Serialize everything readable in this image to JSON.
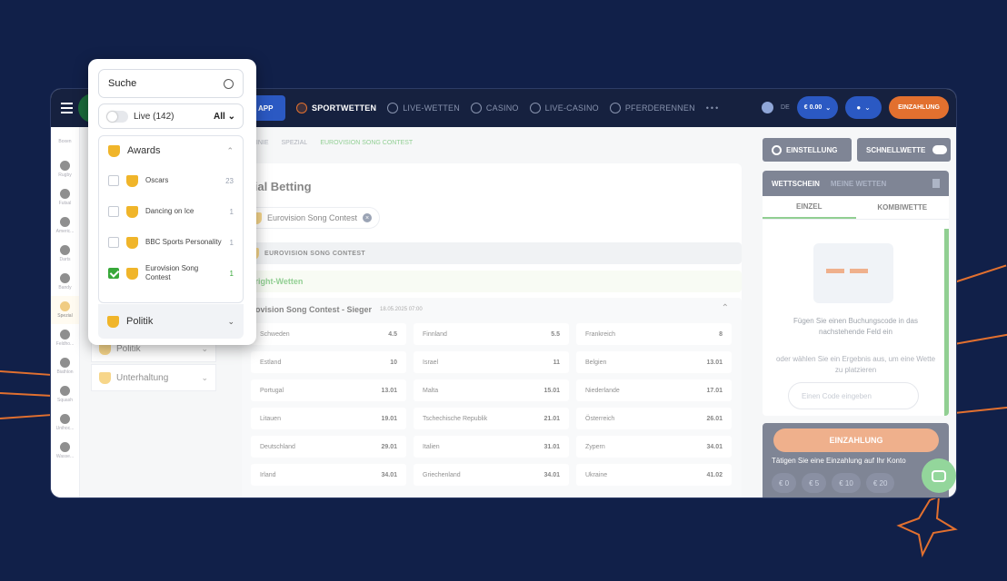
{
  "nav": {
    "app": "APP",
    "items": [
      "SPORTWETTEN",
      "LIVE-WETTEN",
      "CASINO",
      "LIVE-CASINO",
      "PFERDERENNEN"
    ],
    "more": "•••"
  },
  "header_right": {
    "lang": "DE",
    "balance": "€ 0.00",
    "deposit": "EINZAHLUNG"
  },
  "sport_rail": [
    "Boxen",
    "Rugby",
    "Futsal",
    "Americ...",
    "Darts",
    "Bandy",
    "Spezial",
    "Feldho...",
    "Biathlon",
    "Squash",
    "Unihoc...",
    "Wasse..."
  ],
  "left_panel": {
    "items": [
      "Politik",
      "Unterhaltung"
    ]
  },
  "breadcrumb": [
    "LINIE",
    "SPEZIAL",
    "EUROVISION SONG CONTEST"
  ],
  "main": {
    "title": "ezial Betting",
    "chip": "Eurovision Song Contest",
    "section": "EUROVISION SONG CONTEST",
    "subsection": "utright-Wetten",
    "market_title": "urovision Song Contest - Sieger",
    "market_date": "18.05.2025 07:00",
    "odds": [
      [
        "Schweden",
        "4.5"
      ],
      [
        "Finnland",
        "5.5"
      ],
      [
        "Frankreich",
        "8"
      ],
      [
        "Estland",
        "10"
      ],
      [
        "Israel",
        "11"
      ],
      [
        "Belgien",
        "13.01"
      ],
      [
        "Portugal",
        "13.01"
      ],
      [
        "Malta",
        "15.01"
      ],
      [
        "Niederlande",
        "17.01"
      ],
      [
        "Litauen",
        "19.01"
      ],
      [
        "Tschechische Republik",
        "21.01"
      ],
      [
        "Österreich",
        "26.01"
      ],
      [
        "Deutschland",
        "29.01"
      ],
      [
        "Italien",
        "31.01"
      ],
      [
        "Zypern",
        "34.01"
      ],
      [
        "Irland",
        "34.01"
      ],
      [
        "Griechenland",
        "34.01"
      ],
      [
        "Ukraine",
        "41.02"
      ]
    ]
  },
  "right": {
    "settings": "EINSTELLUNG",
    "quickbet": "SCHNELLWETTE",
    "tab_slip": "WETTSCHEIN",
    "tab_my": "MEINE WETTEN",
    "single": "EINZEL",
    "combi": "KOMBIWETTE",
    "msg1": "Fügen Sie einen Buchungscode in das nachstehende Feld ein",
    "msg2": "oder wählen Sie ein Ergebnis aus, um eine Wette zu platzieren",
    "code_placeholder": "Einen Code eingeben",
    "deposit_btn": "EINZAHLUNG",
    "deposit_msg": "Tätigen Sie eine Einzahlung auf Ihr Konto",
    "amounts": [
      "€ 0",
      "€ 5",
      "€ 10",
      "€ 20"
    ]
  },
  "popup": {
    "search": "Suche",
    "live": "Live (142)",
    "all": "All",
    "group": "Awards",
    "subitems": [
      {
        "label": "Oscars",
        "count": "23",
        "checked": false
      },
      {
        "label": "Dancing on Ice",
        "count": "1",
        "checked": false
      },
      {
        "label": "BBC Sports Personality",
        "count": "1",
        "checked": false
      },
      {
        "label": "Eurovision Song Contest",
        "count": "1",
        "checked": true
      }
    ],
    "next_group": "Politik"
  }
}
